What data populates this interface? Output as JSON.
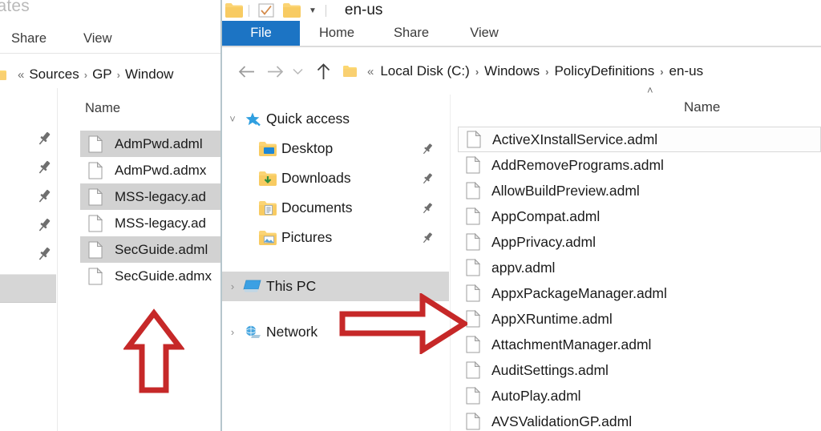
{
  "left_window": {
    "title_partial": "mplates",
    "ribbon_tabs": [
      "Share",
      "View"
    ],
    "address": {
      "overflow_glyph": "«",
      "crumbs": [
        "Sources",
        "GP",
        "Window"
      ],
      "separator": "›"
    },
    "column_header": "Name",
    "files": [
      {
        "name": "AdmPwd.adml",
        "shaded": true
      },
      {
        "name": "AdmPwd.admx",
        "shaded": false
      },
      {
        "name": "MSS-legacy.ad",
        "shaded": true
      },
      {
        "name": "MSS-legacy.ad",
        "shaded": false
      },
      {
        "name": "SecGuide.adml",
        "shaded": true
      },
      {
        "name": "SecGuide.admx",
        "shaded": false
      }
    ],
    "pin_icon": "pin-icon",
    "pin_count": 5
  },
  "right_window": {
    "title": "en-us",
    "quick_access_toolbar": [
      "folder-icon",
      "properties-checkbox-icon",
      "new-folder-icon",
      "chevron-down-icon"
    ],
    "ribbon_tabs": [
      {
        "label": "File",
        "active": true
      },
      {
        "label": "Home",
        "active": false
      },
      {
        "label": "Share",
        "active": false
      },
      {
        "label": "View",
        "active": false
      }
    ],
    "nav_buttons": {
      "back": "back-arrow-icon",
      "forward": "forward-arrow-icon",
      "recent": "recent-locations-chevron-icon",
      "up": "up-arrow-icon"
    },
    "address": {
      "overflow_glyph": "«",
      "crumbs": [
        "Local Disk (C:)",
        "Windows",
        "PolicyDefinitions",
        "en-us"
      ],
      "separator": "›"
    },
    "collapse_chevron": "˄",
    "nav_pane": [
      {
        "label": "Quick access",
        "icon": "star-pin-icon",
        "expander": "˅",
        "pinned": false,
        "indent": false,
        "selected": false
      },
      {
        "label": "Desktop",
        "icon": "desktop-folder-icon",
        "expander": "",
        "pinned": true,
        "indent": true,
        "selected": false
      },
      {
        "label": "Downloads",
        "icon": "downloads-folder-icon",
        "expander": "",
        "pinned": true,
        "indent": true,
        "selected": false
      },
      {
        "label": "Documents",
        "icon": "documents-folder-icon",
        "expander": "",
        "pinned": true,
        "indent": true,
        "selected": false
      },
      {
        "label": "Pictures",
        "icon": "pictures-folder-icon",
        "expander": "",
        "pinned": true,
        "indent": true,
        "selected": false
      },
      {
        "label": "This PC",
        "icon": "this-pc-icon",
        "expander": "›",
        "pinned": false,
        "indent": false,
        "selected": true
      },
      {
        "label": "Network",
        "icon": "network-icon",
        "expander": "›",
        "pinned": false,
        "indent": false,
        "selected": false
      }
    ],
    "column_header": "Name",
    "files": [
      {
        "name": "ActiveXInstallService.adml",
        "focused": true
      },
      {
        "name": "AddRemovePrograms.adml",
        "focused": false
      },
      {
        "name": "AllowBuildPreview.adml",
        "focused": false
      },
      {
        "name": "AppCompat.adml",
        "focused": false
      },
      {
        "name": "AppPrivacy.adml",
        "focused": false
      },
      {
        "name": "appv.adml",
        "focused": false
      },
      {
        "name": "AppxPackageManager.adml",
        "focused": false
      },
      {
        "name": "AppXRuntime.adml",
        "focused": false
      },
      {
        "name": "AttachmentManager.adml",
        "focused": false
      },
      {
        "name": "AuditSettings.adml",
        "focused": false
      },
      {
        "name": "AutoPlay.adml",
        "focused": false
      },
      {
        "name": "AVSValidationGP.adml",
        "focused": false
      }
    ]
  },
  "annotations": [
    {
      "name": "red-up-arrow",
      "direction": "up",
      "color": "#c62828"
    },
    {
      "name": "red-right-arrow",
      "direction": "right",
      "color": "#c62828"
    }
  ],
  "colors": {
    "ribbon_file_tab": "#1c74c4",
    "row_shaded": "#d2d2d2",
    "nav_selected": "#d6d6d6",
    "annotation_red": "#c62828",
    "text_primary": "#1b1b1b",
    "text_muted": "#8f8f8f"
  }
}
